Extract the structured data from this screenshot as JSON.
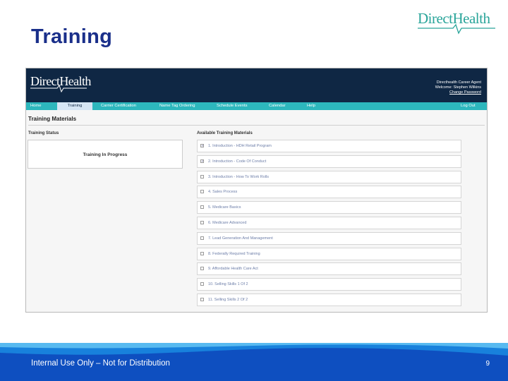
{
  "slide": {
    "title": "Training",
    "logo_text": "DirectHealth",
    "footer_text": "Internal Use Only – Not for Distribution",
    "page_number": "9"
  },
  "app": {
    "logo_text": "DirectHealth",
    "user": {
      "line1": "Directhealth Career Agent",
      "line2": "Welcome: Stephen Wilkins",
      "change_password": "Change Password"
    },
    "nav": [
      "Home",
      "Training",
      "Carrier Certification",
      "Name Tag Ordering",
      "Schedule Events",
      "Calendar",
      "Help",
      "Log Out"
    ],
    "active_nav": "Training",
    "section_title": "Training Materials",
    "status_heading": "Training Status",
    "status_value": "Training In Progress",
    "materials_heading": "Available Training Materials",
    "materials": [
      {
        "label": "1. Introduction - HDH Retail Program",
        "checked": true
      },
      {
        "label": "2. Introduction - Code Of Conduct",
        "checked": true
      },
      {
        "label": "3. Introduction - How To Work Rolls",
        "checked": false
      },
      {
        "label": "4. Sales Process",
        "checked": false
      },
      {
        "label": "5. Medicare Basics",
        "checked": false
      },
      {
        "label": "6. Medicare Advanced",
        "checked": false
      },
      {
        "label": "7. Lead Generation And Management",
        "checked": false
      },
      {
        "label": "8. Federally Required Training",
        "checked": false
      },
      {
        "label": "9. Affordable Health Care Act",
        "checked": false
      },
      {
        "label": "10. Selling Skills 1 Of 2",
        "checked": false
      },
      {
        "label": "11. Selling Skills 2 Of 2",
        "checked": false
      }
    ]
  },
  "colors": {
    "title": "#1a2f8a",
    "app_header": "#0f2744",
    "nav_bar": "#2db7bd",
    "logo": "#2aa59a",
    "footer": "#0e4fc0"
  }
}
